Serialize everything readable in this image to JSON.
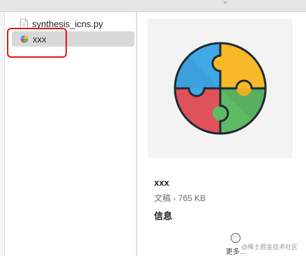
{
  "files": [
    {
      "name": "synthesis_icns.py",
      "icon": "python-document-icon",
      "selected": false
    },
    {
      "name": "xxx",
      "icon": "pie-app-icon",
      "selected": true
    }
  ],
  "preview": {
    "file_name": "xxx",
    "file_kind": "文稿 - 765 KB",
    "info_heading": "信息",
    "more_label": "更多...",
    "more_glyph": "···"
  },
  "watermark": "@稀土掘金技术社区",
  "colors": {
    "highlight": "#e0161a",
    "puzzle_blue": "#3fa9e8",
    "puzzle_yellow": "#f7b928",
    "puzzle_red": "#e0515a",
    "puzzle_green": "#5dbb63",
    "selection": "#d8d8d8"
  }
}
